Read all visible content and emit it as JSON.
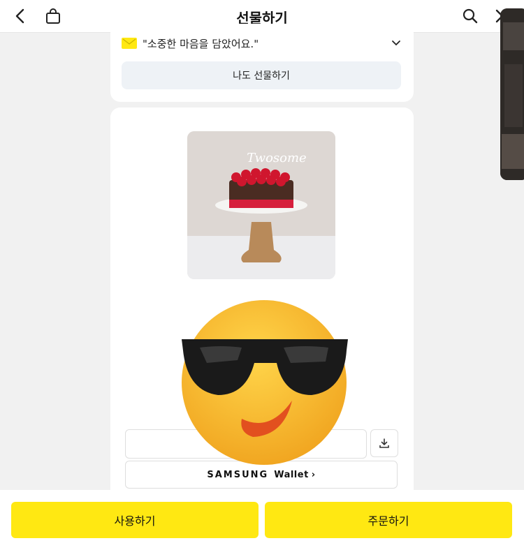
{
  "header": {
    "title": "선물하기",
    "icons": [
      "back-icon",
      "shopping-bag-icon",
      "search-icon",
      "close-icon"
    ]
  },
  "message": {
    "text": "\"소중한 마음을 담았어요.\"",
    "envelope_color": "#ffe812"
  },
  "me_too_button": "나도 선물하기",
  "product": {
    "image_brand_text": "Twosome"
  },
  "wallet": {
    "brand": "SAMSUNG",
    "label": "Wallet",
    "arrow": "›"
  },
  "bottom_buttons": {
    "use": "사용하기",
    "order": "주문하기"
  },
  "colors": {
    "accent": "#ffe812",
    "background": "#f1f1f1"
  }
}
